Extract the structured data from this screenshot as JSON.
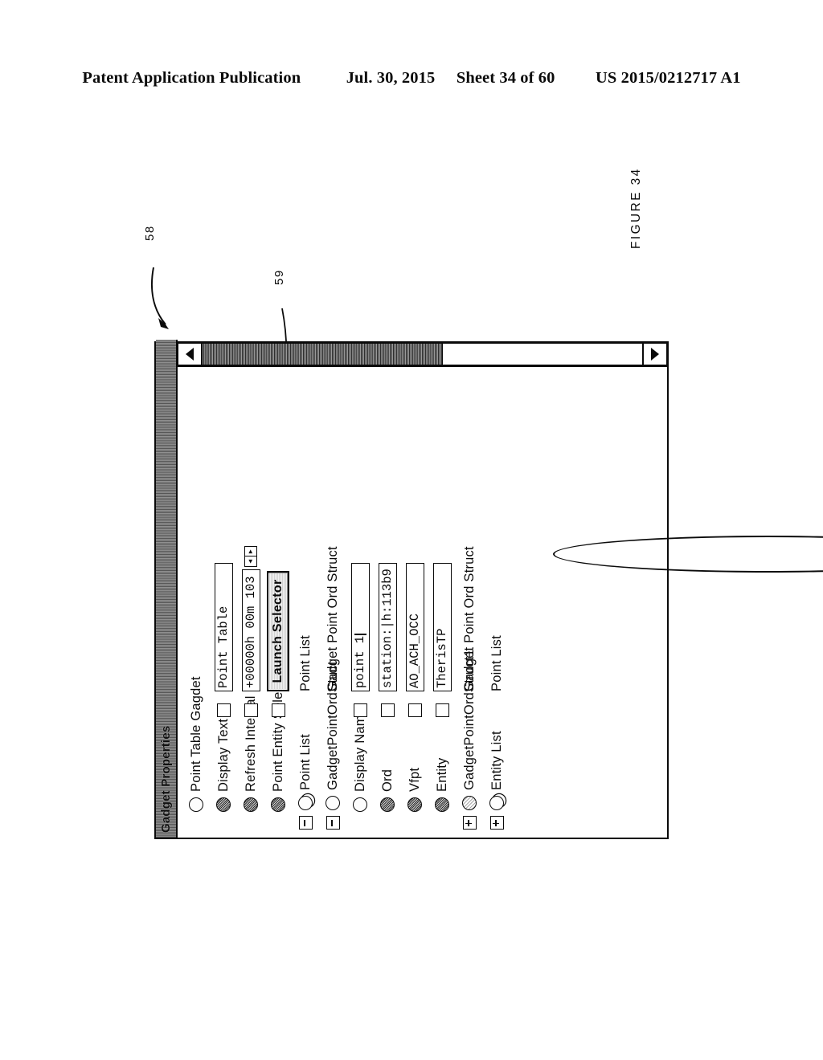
{
  "header": {
    "publication": "Patent Application Publication",
    "date": "Jul. 30, 2015",
    "sheet": "Sheet 34 of 60",
    "patent_number": "US 2015/0212717 A1"
  },
  "figure": {
    "label": "FIGURE 34",
    "reference_numerals": {
      "dialog": "58",
      "highlight": "59"
    }
  },
  "dialog": {
    "title": "Gadget Properties",
    "rows": [
      {
        "label": "Point Table Gagdet",
        "icon": "bullet-hollow-icon",
        "expander": "none",
        "checkbox": false,
        "value_kind": "none",
        "value": "",
        "extra": ""
      },
      {
        "label": "Display Text",
        "icon": "bullet-filled-icon",
        "expander": "none",
        "checkbox": true,
        "value_kind": "text",
        "value": "Point Table",
        "extra": ""
      },
      {
        "label": "Refresh Interval",
        "icon": "bullet-filled-icon",
        "expander": "none",
        "checkbox": true,
        "value_kind": "spinner",
        "value": "+00000h 00m 103",
        "extra": ""
      },
      {
        "label": "Point Entity Selector",
        "icon": "bullet-filled-icon",
        "expander": "none",
        "checkbox": true,
        "value_kind": "button",
        "value": "Launch Selector",
        "extra": ""
      },
      {
        "label": "Point List",
        "icon": "bullet-stack-icon",
        "expander": "minus",
        "checkbox": false,
        "value_kind": "label",
        "value": "Point List",
        "extra": ""
      },
      {
        "label": "GadgetPointOrdStuct",
        "icon": "bullet-hollow-icon",
        "expander": "minus",
        "checkbox": false,
        "value_kind": "label",
        "value": "Gadget Point Ord Struct",
        "extra": ""
      },
      {
        "label": "Display Name",
        "icon": "bullet-hollow-icon",
        "expander": "none",
        "checkbox": true,
        "value_kind": "text",
        "value": "point 1",
        "extra": "caret"
      },
      {
        "label": "Ord",
        "icon": "bullet-filled-icon",
        "expander": "none",
        "checkbox": true,
        "value_kind": "text",
        "value": "station:|h:113b9",
        "extra": ""
      },
      {
        "label": "Vfpt",
        "icon": "bullet-filled-icon",
        "expander": "none",
        "checkbox": true,
        "value_kind": "text",
        "value": "AO_ACH_OCC",
        "extra": ""
      },
      {
        "label": "Entity",
        "icon": "bullet-filled-icon",
        "expander": "none",
        "checkbox": true,
        "value_kind": "text",
        "value": "TherisTP",
        "extra": ""
      },
      {
        "label": "GadgetPointOrdStruct1",
        "icon": "bullet-hatch-icon",
        "expander": "plus",
        "checkbox": false,
        "value_kind": "label",
        "value": "Gadget Point Ord Struct",
        "extra": ""
      },
      {
        "label": "Entity List",
        "icon": "bullet-stack-icon",
        "expander": "plus",
        "checkbox": false,
        "value_kind": "label",
        "value": "Point List",
        "extra": ""
      }
    ],
    "scrollbar": {
      "up_arrow": "▲",
      "down_arrow": "▼"
    },
    "spinner": {
      "decrement": "◄",
      "increment": "►"
    }
  }
}
